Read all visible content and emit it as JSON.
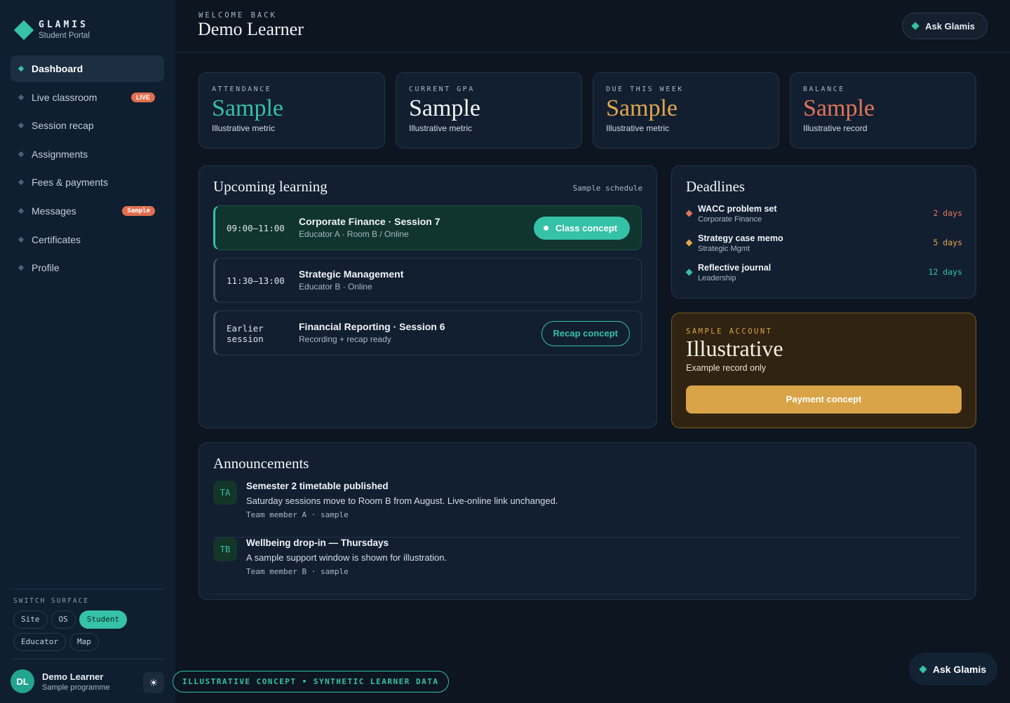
{
  "brand": {
    "name": "GLAMIS",
    "subtitle": "Student Portal"
  },
  "nav": [
    {
      "label": "Dashboard",
      "active": true
    },
    {
      "label": "Live classroom",
      "badge": "LIVE"
    },
    {
      "label": "Session recap"
    },
    {
      "label": "Assignments"
    },
    {
      "label": "Fees & payments"
    },
    {
      "label": "Messages",
      "badge": "Sample"
    },
    {
      "label": "Certificates"
    },
    {
      "label": "Profile"
    }
  ],
  "switch_surface": {
    "title": "SWITCH SURFACE",
    "options": [
      "Site",
      "OS",
      "Student",
      "Educator",
      "Map"
    ],
    "selected": "Student"
  },
  "user": {
    "initials": "DL",
    "name": "Demo Learner",
    "programme": "Sample programme",
    "theme_icon": "☀"
  },
  "header": {
    "welcome": "WELCOME BACK",
    "name": "Demo Learner",
    "ask_label": "Ask Glamis"
  },
  "metrics": [
    {
      "label": "ATTENDANCE",
      "value": "Sample",
      "sub": "Illustrative metric",
      "color": "#35c2a6"
    },
    {
      "label": "CURRENT GPA",
      "value": "Sample",
      "sub": "Illustrative metric",
      "color": "#f1f5f8"
    },
    {
      "label": "DUE THIS WEEK",
      "value": "Sample",
      "sub": "Illustrative metric",
      "color": "#e3a64f"
    },
    {
      "label": "BALANCE",
      "value": "Sample",
      "sub": "Illustrative record",
      "color": "#e3745a"
    }
  ],
  "upcoming": {
    "title": "Upcoming learning",
    "tag": "Sample schedule",
    "sessions": [
      {
        "time": "09:00–11:00",
        "title": "Corporate Finance · Session 7",
        "sub": "Educator A · Room B / Online",
        "action": "Class concept"
      },
      {
        "time": "11:30–13:00",
        "title": "Strategic Management",
        "sub": "Educator B · Online"
      },
      {
        "time_line1": "Earlier",
        "time_line2": "session",
        "title": "Financial Reporting · Session 6",
        "sub": "Recording + recap ready",
        "action": "Recap concept"
      }
    ]
  },
  "deadlines": {
    "title": "Deadlines",
    "items": [
      {
        "title": "WACC problem set",
        "course": "Corporate Finance",
        "due": "2 days",
        "color": "#e3745a"
      },
      {
        "title": "Strategy case memo",
        "course": "Strategic Mgmt",
        "due": "5 days",
        "color": "#e3a64f"
      },
      {
        "title": "Reflective journal",
        "course": "Leadership",
        "due": "12 days",
        "color": "#35c2a6"
      }
    ]
  },
  "account": {
    "label": "SAMPLE ACCOUNT",
    "value": "Illustrative",
    "sub": "Example record only",
    "button": "Payment concept"
  },
  "announcements": {
    "title": "Announcements",
    "items": [
      {
        "initials": "TA",
        "title": "Semester 2 timetable published",
        "body": "Saturday sessions move to Room B from August. Live-online link unchanged.",
        "meta": "Team member A · sample"
      },
      {
        "initials": "TB",
        "title": "Wellbeing drop-in — Thursdays",
        "body": "A sample support window is shown for illustration.",
        "meta": "Team member B · sample"
      }
    ]
  },
  "banner": "ILLUSTRATIVE CONCEPT • SYNTHETIC LEARNER DATA",
  "float_ask": "Ask Glamis"
}
